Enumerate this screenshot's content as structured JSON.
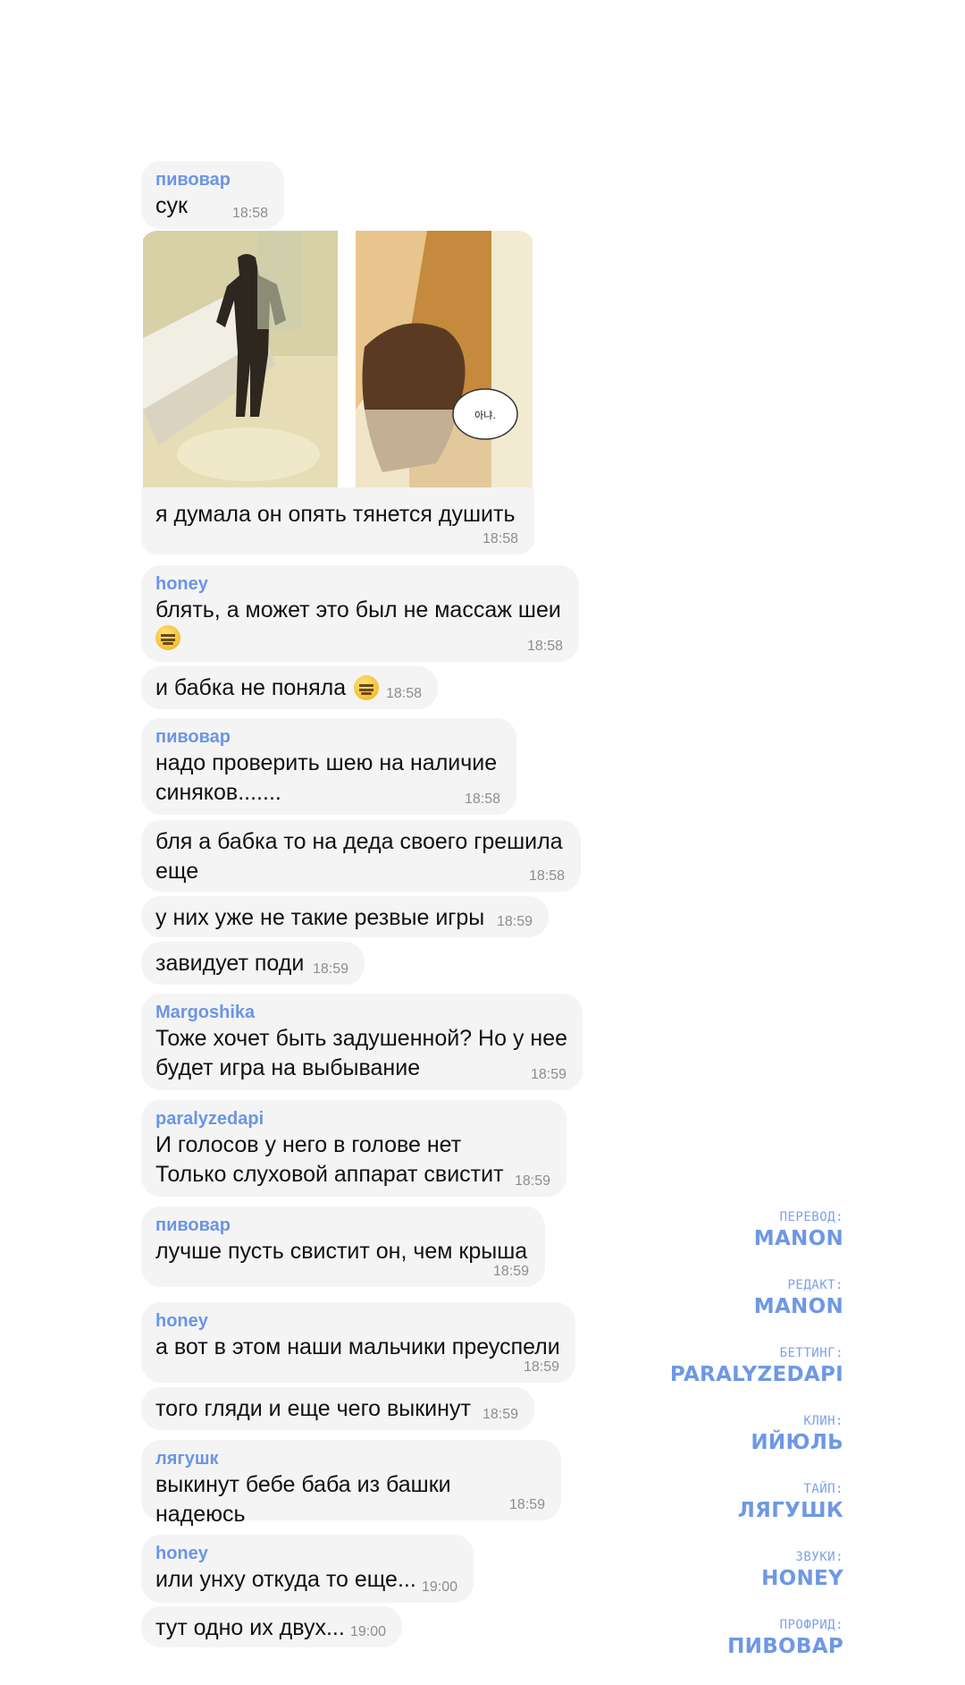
{
  "messages": {
    "m1": {
      "sender": "пивовар",
      "text": "сук",
      "time": "18:58"
    },
    "m2": {
      "text": "я думала он опять тянется душить",
      "time": "18:58",
      "image_bubble_text": "아냐."
    },
    "m3": {
      "sender": "honey",
      "text": "блять, а может это был не массаж шеи",
      "time": "18:58"
    },
    "m4": {
      "text": "и бабка не поняла",
      "time": "18:58"
    },
    "m5": {
      "sender": "пивовар",
      "text": "надо проверить шею на наличие\nсиняков.......",
      "time": "18:58"
    },
    "m6": {
      "text": "бля а бабка то на деда своего грешила\nеще",
      "time": "18:58"
    },
    "m7": {
      "text": "у них уже не такие резвые игры",
      "time": "18:59"
    },
    "m8": {
      "text": "завидует поди",
      "time": "18:59"
    },
    "m9": {
      "sender": "Margoshika",
      "text": "Тоже хочет быть задушенной? Но у нее\nбудет игра на выбывание",
      "time": "18:59"
    },
    "m10": {
      "sender": "paralyzedapi",
      "text": "И голосов у него в голове нет\nТолько слуховой аппарат свистит",
      "time": "18:59"
    },
    "m11": {
      "sender": "пивовар",
      "text": "лучше пусть свистит он, чем крыша",
      "time": "18:59"
    },
    "m12": {
      "sender": "honey",
      "text": "а вот в этом наши мальчики преуспели",
      "time": "18:59"
    },
    "m13": {
      "text": "того гляди и еще чего выкинут",
      "time": "18:59"
    },
    "m14": {
      "sender": "лягушк",
      "text": "выкинут бебе баба из башки надеюсь",
      "time": "18:59"
    },
    "m15": {
      "sender": "honey",
      "text": "или унху откуда то еще...",
      "time": "19:00"
    },
    "m16": {
      "text": "тут одно их двух...",
      "time": "19:00"
    }
  },
  "credits": [
    {
      "role": "ПЕРЕВОД:",
      "name": "MANON"
    },
    {
      "role": "РЕДАКТ:",
      "name": "MANON"
    },
    {
      "role": "БЕТТИНГ:",
      "name": "PARALYZEDAPI"
    },
    {
      "role": "КЛИН:",
      "name": "ИЙЮЛЬ"
    },
    {
      "role": "ТАЙП:",
      "name": "ЛЯГУШК"
    },
    {
      "role": "ЗВУКИ:",
      "name": "HONEY"
    },
    {
      "role": "ПРОФРИД:",
      "name": "ПИВОВАР"
    }
  ],
  "colors": {
    "sender": "#6b95e6",
    "bubble": "#f4f4f4",
    "credit": "#6e98e6"
  },
  "icons": {
    "emoji": "expressionless-face-emoji"
  }
}
